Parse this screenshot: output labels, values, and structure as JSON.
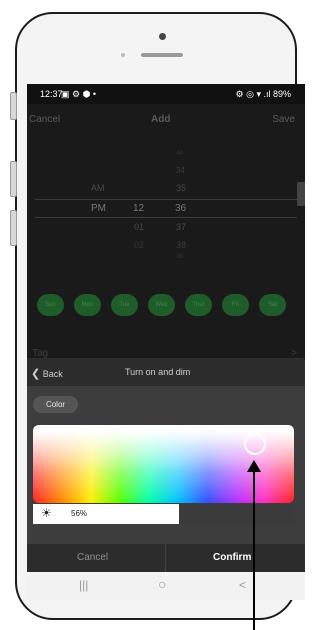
{
  "status_bar": {
    "time": "12:37",
    "left_icons": "▣ ⚙ ⬢ •",
    "right_icons": "⚙ ◎ ▾ .ıl",
    "battery": "89%"
  },
  "header": {
    "cancel": "Cancel",
    "title": "Add",
    "save": "Save"
  },
  "picker": {
    "ampm": [
      "AM",
      "PM"
    ],
    "hours": [
      "12",
      "01",
      "02"
    ],
    "minutes": [
      "33",
      "34",
      "35",
      "36",
      "37",
      "38",
      "39"
    ],
    "selected": {
      "ampm": "PM",
      "hour": "12",
      "minute": "36"
    }
  },
  "days": [
    "Sun",
    "Mon",
    "Tue",
    "Wed",
    "Thur",
    "Fri",
    "Sat"
  ],
  "tag": {
    "label": "Tag",
    "arrow": ">"
  },
  "sheet": {
    "back": "Back",
    "title": "Turn on and dim",
    "chip": "Color",
    "brightness_pct": "56%",
    "brightness_level": 0.56
  },
  "footer": {
    "cancel": "Cancel",
    "confirm": "Confirm"
  },
  "nav": {
    "recent": "|||",
    "home": "○",
    "back": "<"
  },
  "colors": {
    "screen_bg": "#1a1a1a",
    "day_green": "#1e5c2a",
    "sheet": "#3d3d3d"
  }
}
